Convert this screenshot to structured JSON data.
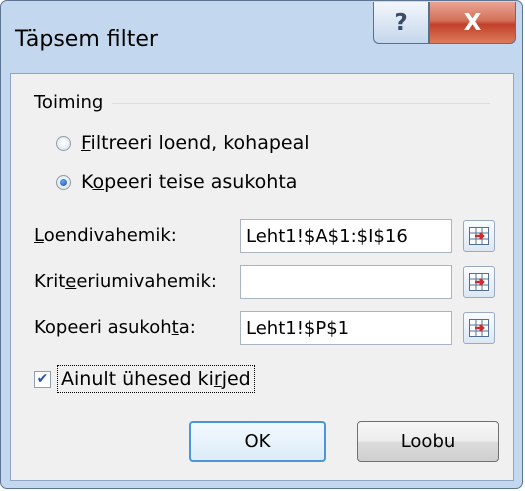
{
  "window": {
    "title": "Täpsem filter",
    "help_glyph": "?",
    "close_glyph": "X"
  },
  "action_group": {
    "label": "Toiming",
    "option_filter": {
      "mnemonic": "F",
      "rest": "iltreeri loend, kohapeal",
      "selected": false
    },
    "option_copy": {
      "pre": "K",
      "mnemonic": "o",
      "rest": "peeri teise asukohta",
      "selected": true
    }
  },
  "fields": {
    "list_range": {
      "pre": "",
      "mnemonic": "L",
      "rest": "oendivahemik:",
      "value": "Leht1!$A$1:$I$16"
    },
    "criteria_range": {
      "pre": "Krit",
      "mnemonic": "e",
      "rest": "eriumivahemik:",
      "value": ""
    },
    "copy_to": {
      "pre": "Kopeeri asukoh",
      "mnemonic": "t",
      "rest": "a:",
      "value": "Leht1!$P$1"
    }
  },
  "unique_only": {
    "pre": "Ainult ühesed ki",
    "mnemonic": "r",
    "rest": "jed",
    "checked": true
  },
  "buttons": {
    "ok": "OK",
    "cancel": "Loobu"
  },
  "icons": {
    "collapse": "range-selector-icon",
    "radio_selected_color": "#1a4fa0",
    "check_color": "#2a55a6"
  }
}
